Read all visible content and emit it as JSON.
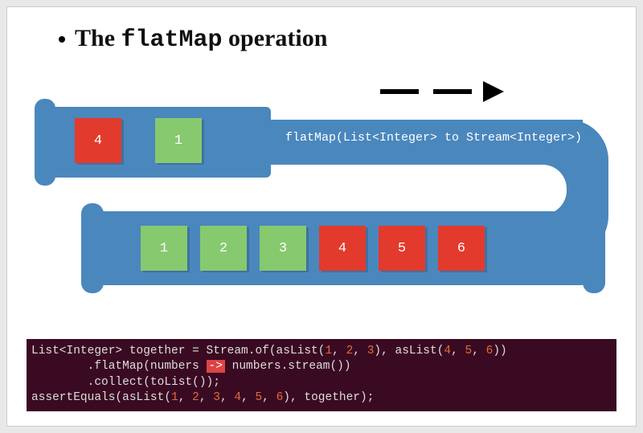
{
  "title": {
    "pre": "The ",
    "mono": "flatMap",
    "post": " operation"
  },
  "flatmap_label": "flatMap(List<Integer> to Stream<Integer>)",
  "top_items": [
    {
      "color": "red",
      "label": "4"
    },
    {
      "color": "green",
      "label": "1"
    }
  ],
  "bottom_items": [
    {
      "color": "green",
      "label": "1"
    },
    {
      "color": "green",
      "label": "2"
    },
    {
      "color": "green",
      "label": "3"
    },
    {
      "color": "red",
      "label": "4"
    },
    {
      "color": "red",
      "label": "5"
    },
    {
      "color": "red",
      "label": "6"
    }
  ],
  "code": {
    "l1a": "List<Integer> together = Stream.of(asList(",
    "l1n1": "1",
    "l1s1": ", ",
    "l1n2": "2",
    "l1s2": ", ",
    "l1n3": "3",
    "l1b": "), asList(",
    "l1n4": "4",
    "l1s3": ", ",
    "l1n5": "5",
    "l1s4": ", ",
    "l1n6": "6",
    "l1c": "))",
    "l2a": "        .flatMap(numbers ",
    "l2op": "->",
    "l2b": " numbers.stream())",
    "l3": "        .collect(toList());",
    "l4a": "assertEquals(asList(",
    "l4n1": "1",
    "l4s1": ", ",
    "l4n2": "2",
    "l4s2": ", ",
    "l4n3": "3",
    "l4s3": ", ",
    "l4n4": "4",
    "l4s4": ", ",
    "l4n5": "5",
    "l4s5": ", ",
    "l4n6": "6",
    "l4b": "), together);"
  }
}
